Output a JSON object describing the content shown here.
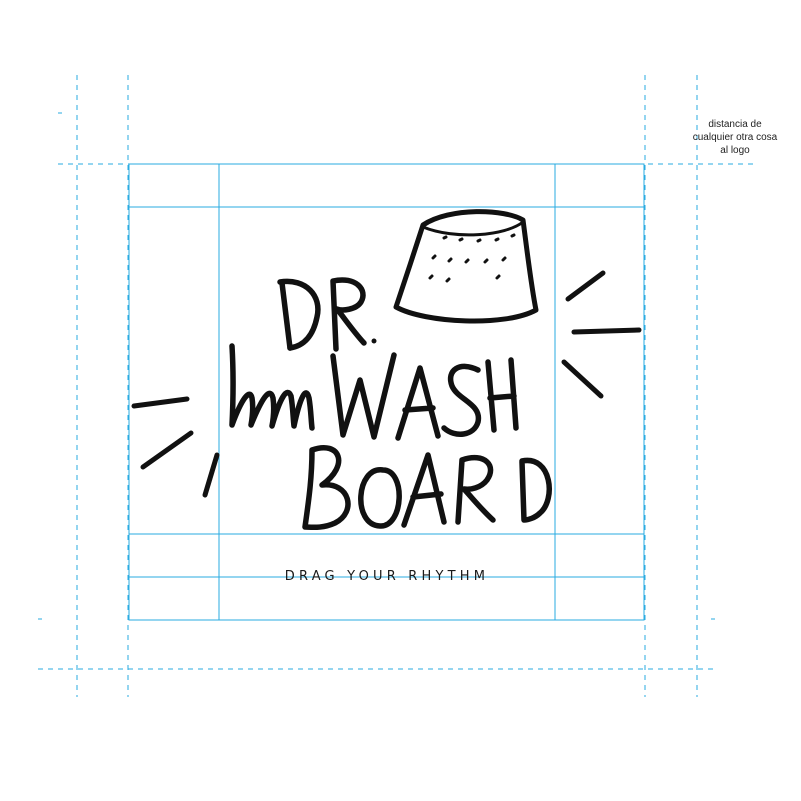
{
  "logo": {
    "brand_line_1": "DR.",
    "brand_line_2": "WASH",
    "brand_line_3": "BOARD",
    "tagline": "DRAG YOUR RHYTHM",
    "ink_color": "#111111"
  },
  "guides": {
    "note": "distancia de cualquier otra cosa al logo",
    "guide_color": "#29abe2"
  }
}
